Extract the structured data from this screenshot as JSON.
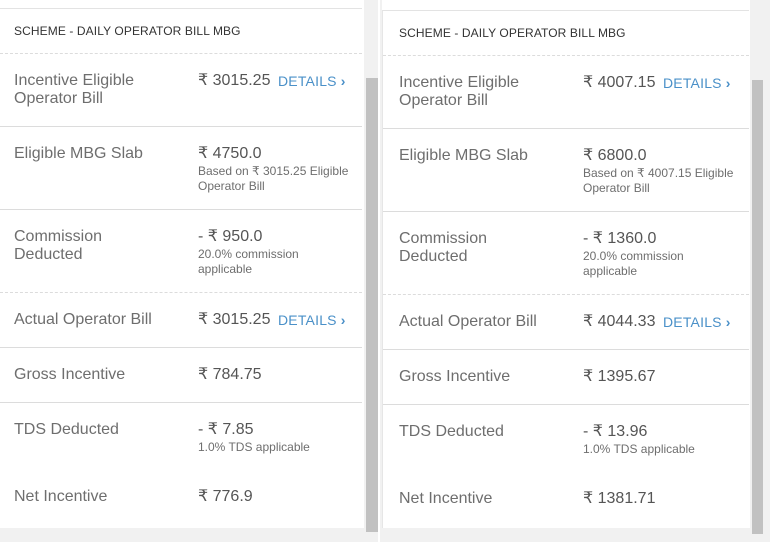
{
  "panels": [
    {
      "scheme_title": "SCHEME - DAILY OPERATOR BILL MBG",
      "rows": [
        {
          "label": "Incentive Eligible Operator Bill",
          "amount": "₹ 3015.25",
          "sub": "",
          "details": "DETAILS"
        },
        {
          "label": "Eligible MBG Slab",
          "amount": "₹ 4750.0",
          "sub": "Based on ₹ 3015.25 Eligible Operator Bill",
          "details": ""
        },
        {
          "label": "Commission Deducted",
          "amount": "- ₹ 950.0",
          "sub": "20.0% commission applicable",
          "details": ""
        },
        {
          "label": "Actual Operator Bill",
          "amount": "₹ 3015.25",
          "sub": "",
          "details": "DETAILS"
        },
        {
          "label": "Gross Incentive",
          "amount": "₹ 784.75",
          "sub": "",
          "details": ""
        },
        {
          "label": "TDS Deducted",
          "amount": "- ₹ 7.85",
          "sub": "1.0% TDS applicable",
          "details": ""
        },
        {
          "label": "Net Incentive",
          "amount": "₹ 776.9",
          "sub": "",
          "details": ""
        }
      ]
    },
    {
      "scheme_title": "SCHEME - DAILY OPERATOR BILL MBG",
      "rows": [
        {
          "label": "Incentive Eligible Operator Bill",
          "amount": "₹ 4007.15",
          "sub": "",
          "details": "DETAILS"
        },
        {
          "label": "Eligible MBG Slab",
          "amount": "₹ 6800.0",
          "sub": "Based on ₹ 4007.15 Eligible Operator Bill",
          "details": ""
        },
        {
          "label": "Commission Deducted",
          "amount": "- ₹ 1360.0",
          "sub": "20.0% commission applicable",
          "details": ""
        },
        {
          "label": "Actual Operator Bill",
          "amount": "₹ 4044.33",
          "sub": "",
          "details": "DETAILS"
        },
        {
          "label": "Gross Incentive",
          "amount": "₹ 1395.67",
          "sub": "",
          "details": ""
        },
        {
          "label": "TDS Deducted",
          "amount": "- ₹ 13.96",
          "sub": "1.0% TDS applicable",
          "details": ""
        },
        {
          "label": "Net Incentive",
          "amount": "₹ 1381.71",
          "sub": "",
          "details": ""
        }
      ]
    }
  ],
  "icons": {
    "details_chevron": "chevron-right-icon"
  },
  "colors": {
    "link": "#4a90c8",
    "label": "#6e6e6e",
    "value": "#555555"
  }
}
